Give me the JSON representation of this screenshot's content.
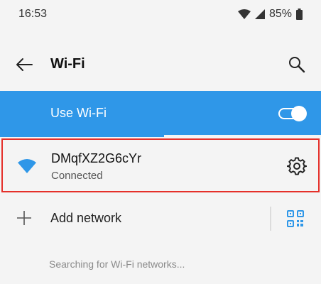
{
  "status_bar": {
    "time": "16:53",
    "battery_percent": "85%",
    "icons": [
      "wifi-signal-icon",
      "cell-signal-icon",
      "battery-icon"
    ]
  },
  "app_bar": {
    "title": "Wi-Fi",
    "icons": [
      "back-arrow-icon",
      "search-icon"
    ]
  },
  "use_wifi": {
    "label": "Use Wi-Fi",
    "enabled": true,
    "scan_progress": 0.51
  },
  "connected_network": {
    "ssid": "DMqfXZ2G6cYr",
    "status": "Connected",
    "icons": [
      "wifi-icon",
      "gear-icon"
    ]
  },
  "add_network": {
    "label": "Add network",
    "icons": [
      "plus-icon",
      "qr-code-icon"
    ]
  },
  "scan_status": "Searching for Wi-Fi networks...",
  "colors": {
    "accent": "#2f97e8",
    "highlight_border": "#e5302a",
    "background": "#f4f4f4"
  }
}
